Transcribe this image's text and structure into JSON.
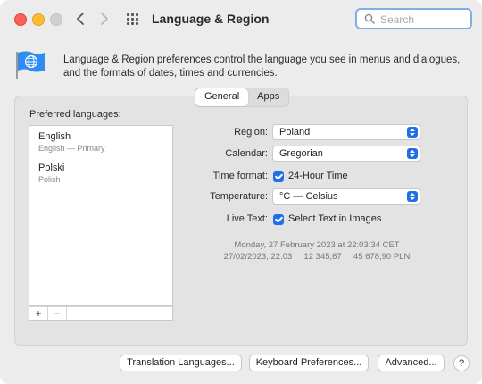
{
  "window": {
    "title": "Language & Region"
  },
  "search": {
    "placeholder": "Search"
  },
  "description": "Language & Region preferences control the language you see in menus and dialogues, and the formats of dates, times and currencies.",
  "tabs": [
    {
      "label": "General",
      "active": true
    },
    {
      "label": "Apps",
      "active": false
    }
  ],
  "preferred": {
    "label": "Preferred languages:",
    "items": [
      {
        "name": "English",
        "sub": "English — Primary"
      },
      {
        "name": "Polski",
        "sub": "Polish"
      }
    ],
    "add_label": "+",
    "remove_label": "−"
  },
  "settings": {
    "region": {
      "label": "Region:",
      "value": "Poland"
    },
    "calendar": {
      "label": "Calendar:",
      "value": "Gregorian"
    },
    "time_format": {
      "label": "Time format:",
      "text": "24-Hour Time",
      "checked": true
    },
    "temperature": {
      "label": "Temperature:",
      "value": "°C — Celsius"
    },
    "live_text": {
      "label": "Live Text:",
      "text": "Select Text in Images",
      "checked": true
    }
  },
  "sample": {
    "line1": "Monday, 27 February 2023 at 22:03:34 CET",
    "line2": "27/02/2023, 22:03     12 345,67     45 678,90 PLN"
  },
  "buttons": {
    "translation": "Translation Languages...",
    "keyboard": "Keyboard Preferences...",
    "advanced": "Advanced...",
    "help": "?"
  },
  "colors": {
    "accent": "#1e6fe8",
    "close": "#fe5f57",
    "minimize": "#febc2e"
  },
  "icons": {
    "back": "chevron-left-icon",
    "forward": "chevron-right-icon",
    "grid": "grid-icon",
    "search": "search-icon",
    "flag": "flag-globe-icon"
  }
}
